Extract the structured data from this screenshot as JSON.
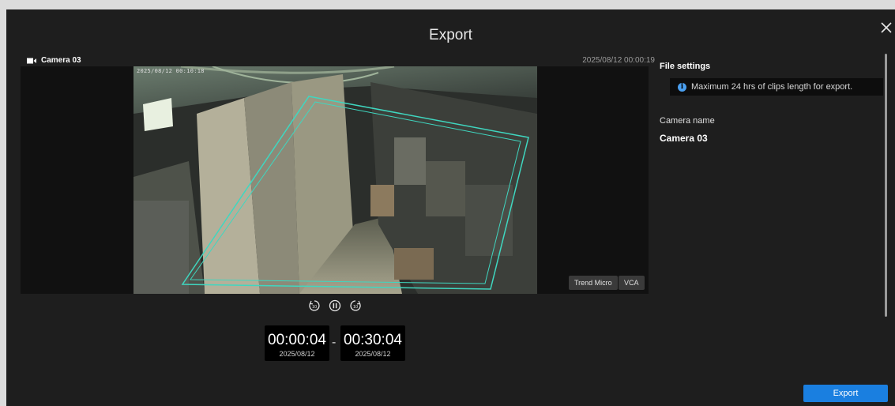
{
  "dialog": {
    "title": "Export"
  },
  "camera": {
    "name": "Camera 03",
    "timestamp": "2025/08/12 00:00:19",
    "osd_text": "2025/08/12 00:10:18"
  },
  "video_tags": {
    "trend_micro": "Trend Micro",
    "vca": "VCA"
  },
  "playback": {
    "rewind_icon": "rewind-10-icon",
    "pause_icon": "pause-icon",
    "forward_icon": "forward-10-icon"
  },
  "range": {
    "start_time": "00:00:04",
    "start_date": "2025/08/12",
    "separator": "-",
    "end_time": "00:30:04",
    "end_date": "2025/08/12"
  },
  "side": {
    "section_title": "File settings",
    "info_text": "Maximum 24 hrs of clips length for export.",
    "info_icon": "info-icon",
    "camera_label": "Camera name",
    "camera_value": "Camera 03"
  },
  "footer": {
    "export_label": "Export"
  },
  "colors": {
    "accent": "#1a7fe0",
    "dialog_bg": "#1e1e1e",
    "vca_line": "#3fd7c0"
  }
}
